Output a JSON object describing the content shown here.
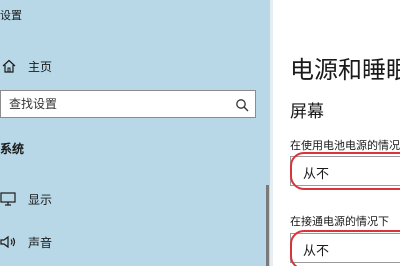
{
  "window": {
    "title": "设置"
  },
  "sidebar": {
    "home_label": "主页",
    "search_placeholder": "查找设置",
    "section_label": "系统",
    "items": [
      {
        "label": "显示",
        "icon": "monitor-icon"
      },
      {
        "label": "声音",
        "icon": "speaker-icon"
      }
    ]
  },
  "main": {
    "title": "电源和睡眠",
    "section": "屏幕",
    "battery_label": "在使用电池电源的情况下",
    "battery_value": "从不",
    "plugged_label": "在接通电源的情况下",
    "plugged_value": "从不"
  },
  "colors": {
    "sidebar_bg": "#b8d8e8",
    "highlight": "#d9343a"
  }
}
